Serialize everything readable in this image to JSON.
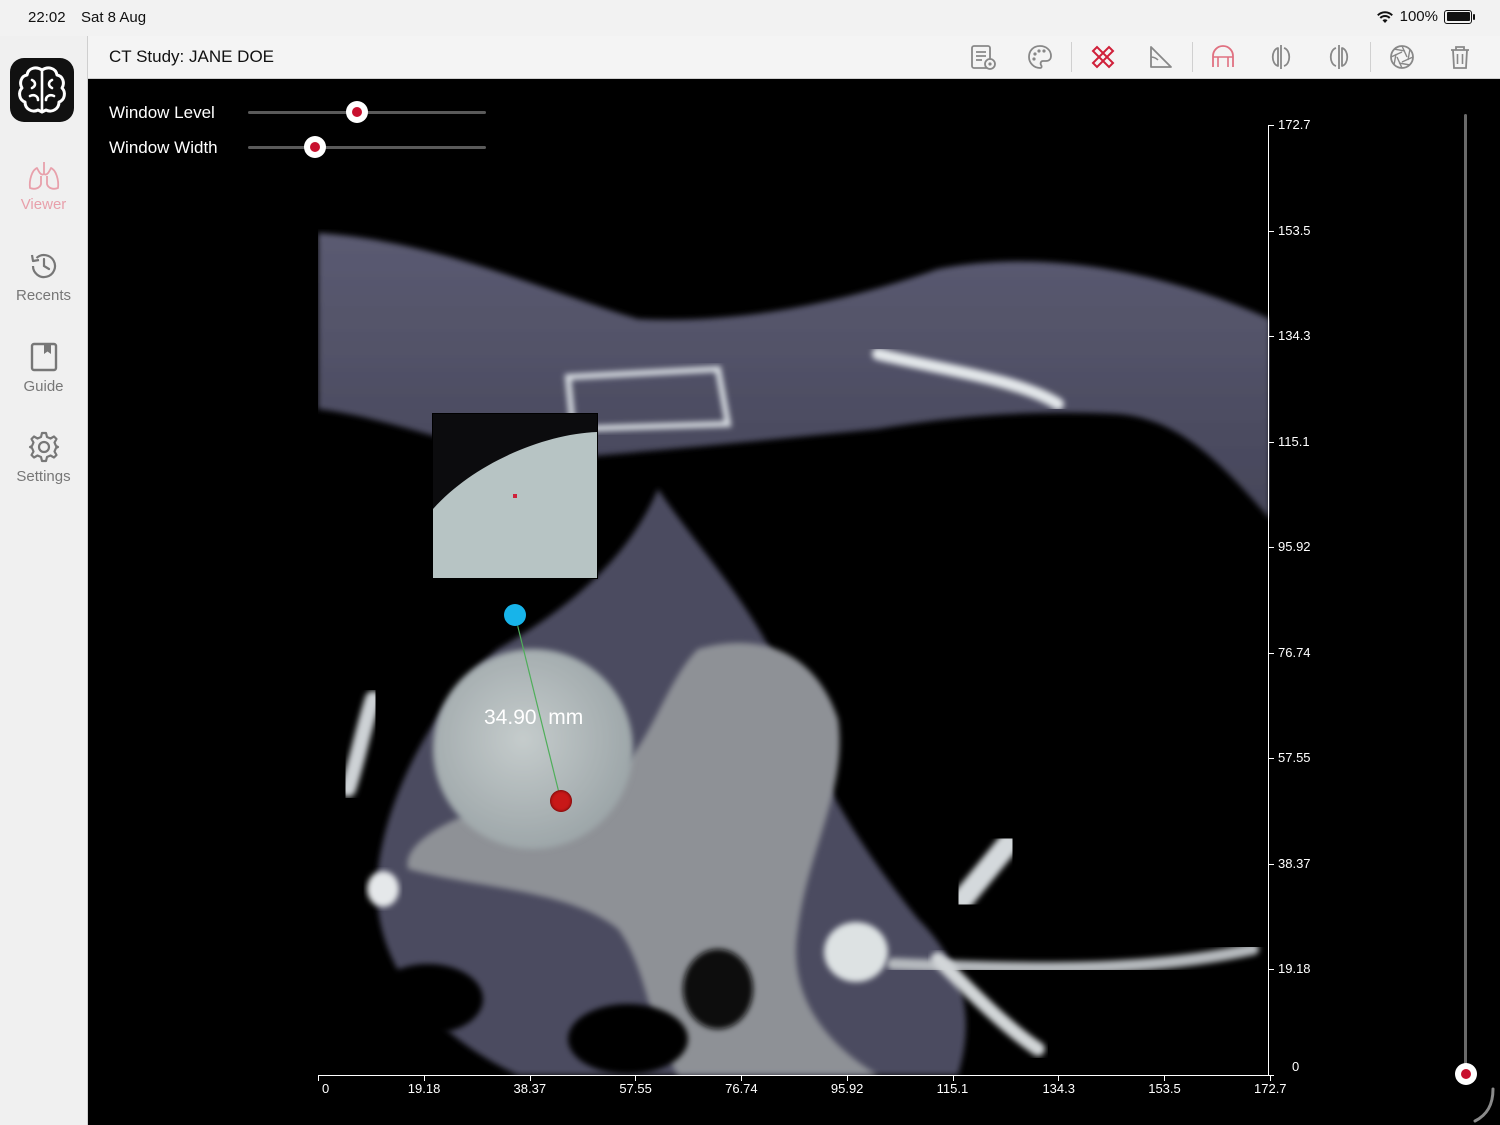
{
  "status": {
    "time": "22:02",
    "date": "Sat 8 Aug",
    "battery": "100%"
  },
  "sidebar": {
    "items": [
      {
        "label": "Viewer",
        "icon": "lungs-icon",
        "active": true
      },
      {
        "label": "Recents",
        "icon": "history-icon"
      },
      {
        "label": "Guide",
        "icon": "book-icon"
      },
      {
        "label": "Settings",
        "icon": "gear-icon"
      }
    ]
  },
  "toolbar": {
    "title": "CT Study: JANE DOE",
    "tools": [
      "report-icon",
      "palette-icon",
      "measure-ruler-icon",
      "angle-icon",
      "roi-arch-icon",
      "flip-horizontal-icon",
      "flip-vertical-icon",
      "aperture-icon",
      "trash-icon"
    ],
    "accent_color": "#d0203a"
  },
  "controls": {
    "window_level_label": "Window Level",
    "window_width_label": "Window Width",
    "window_level_value": 0.46,
    "window_width_value": 0.28
  },
  "measurement": {
    "value": "34.90",
    "unit": "mm"
  },
  "axes": {
    "x_ticks": [
      "0",
      "19.18",
      "38.37",
      "57.55",
      "76.74",
      "95.92",
      "115.1",
      "134.3",
      "153.5",
      "172.7"
    ],
    "y_ticks": [
      "172.7",
      "153.5",
      "134.3",
      "115.1",
      "95.92",
      "76.74",
      "57.55",
      "38.37",
      "19.18",
      "0"
    ]
  },
  "slice_slider": {
    "value": 0.0
  }
}
